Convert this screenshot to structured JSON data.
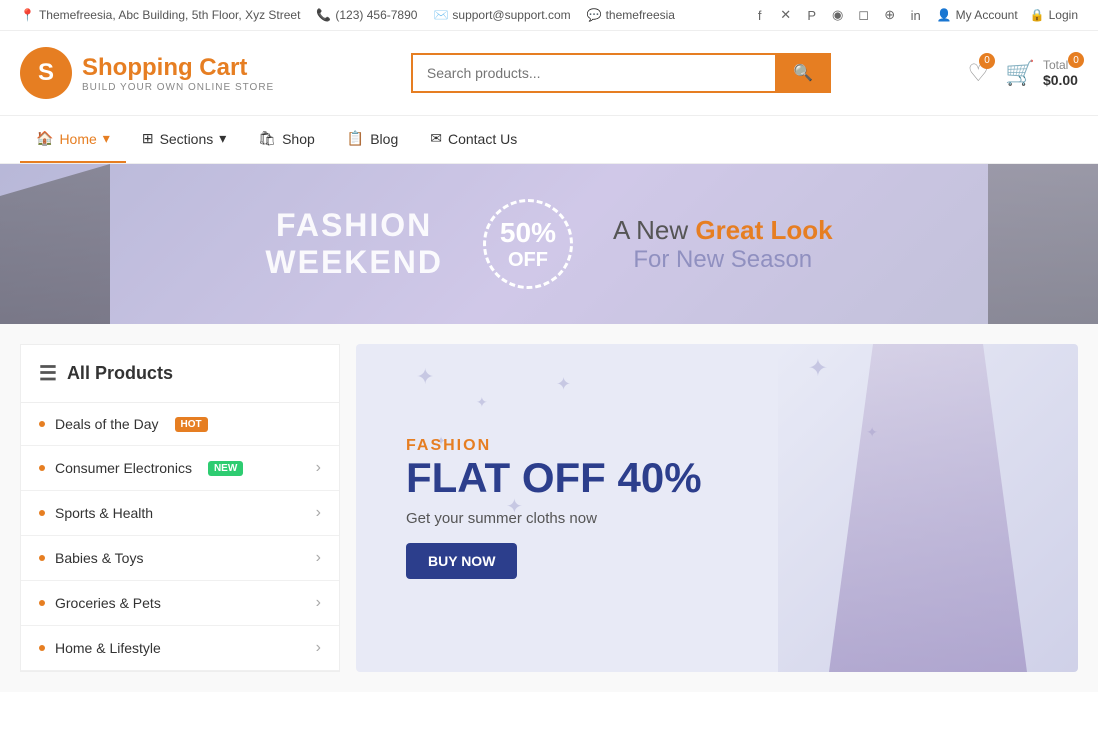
{
  "topbar": {
    "address": "Themefreesia, Abc Building, 5th Floor, Xyz Street",
    "phone": "(123) 456-7890",
    "email": "support@support.com",
    "skype": "themefreesia",
    "my_account": "My Account",
    "login": "Login"
  },
  "social": {
    "icons": [
      "facebook",
      "twitter",
      "pinterest",
      "dribbble",
      "instagram",
      "flickr",
      "linkedin"
    ]
  },
  "header": {
    "logo_letter": "S",
    "logo_title": "Shopping Cart",
    "logo_subtitle": "BUILD YOUR OWN ONLINE STORE",
    "search_placeholder": "Search products...",
    "search_btn_icon": "🔍",
    "wishlist_count": "0",
    "cart_count": "0",
    "cart_total_label": "Total",
    "cart_total": "$0.00"
  },
  "nav": {
    "items": [
      {
        "label": "Home",
        "has_dropdown": true,
        "active": true
      },
      {
        "label": "Sections",
        "has_dropdown": true,
        "active": false
      },
      {
        "label": "Shop",
        "has_dropdown": false,
        "active": false
      },
      {
        "label": "Blog",
        "has_dropdown": false,
        "active": false
      },
      {
        "label": "Contact Us",
        "has_dropdown": false,
        "active": false
      }
    ]
  },
  "hero": {
    "text1": "FASHION",
    "text2": "WEEKEND",
    "percent": "50%",
    "off": "OFF",
    "headline_pre": "A New",
    "headline_highlight": "Great Look",
    "headline_post": "For New Season"
  },
  "sidebar": {
    "header": "All Products",
    "items": [
      {
        "label": "Deals of the Day",
        "badge": "HOT",
        "badge_type": "hot",
        "has_arrow": false
      },
      {
        "label": "Consumer Electronics",
        "badge": "NEW",
        "badge_type": "new",
        "has_arrow": true
      },
      {
        "label": "Sports & Health",
        "badge": "",
        "badge_type": "",
        "has_arrow": true
      },
      {
        "label": "Babies & Toys",
        "badge": "",
        "badge_type": "",
        "has_arrow": true
      },
      {
        "label": "Groceries & Pets",
        "badge": "",
        "badge_type": "",
        "has_arrow": true
      },
      {
        "label": "Home & Lifestyle",
        "badge": "",
        "badge_type": "",
        "has_arrow": true
      }
    ]
  },
  "promo": {
    "category": "FASHION",
    "title_line1": "FLAT OFF 40%",
    "cta": "BUY NOW",
    "subtitle": "Get your summer cloths now"
  }
}
